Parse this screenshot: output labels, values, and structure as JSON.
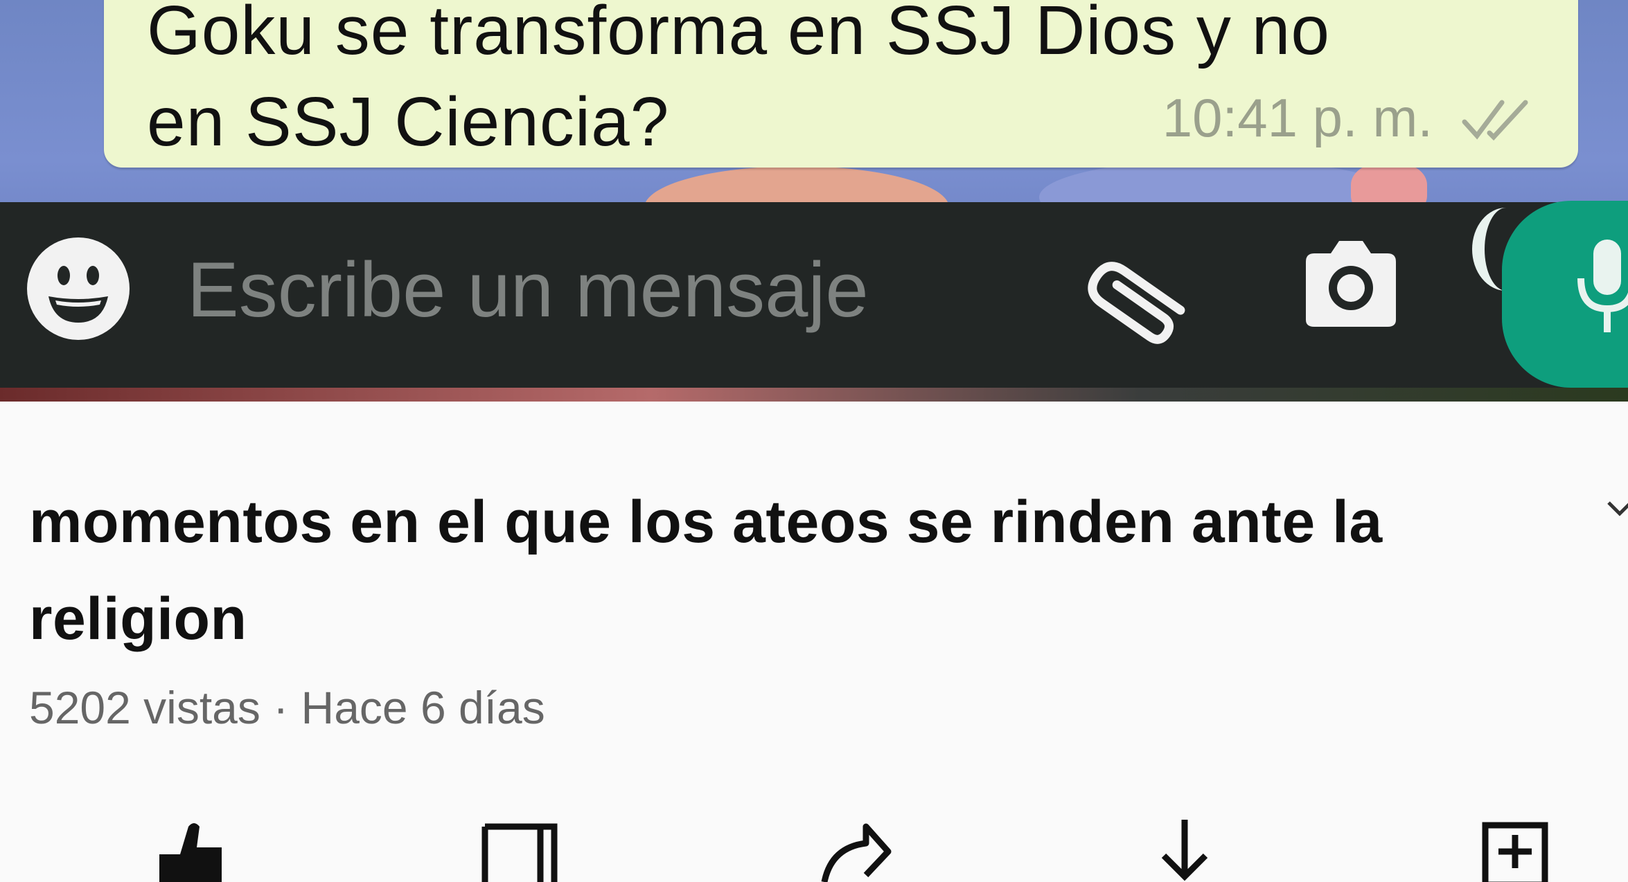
{
  "chat": {
    "message_text": "Goku se transforma en SSJ Dios y no\nen SSJ Ciencia?",
    "message_time": "10:41 p. m.",
    "input_placeholder": "Escribe un mensaje"
  },
  "video": {
    "title": "momentos en el que los ateos se rinden ante la religion",
    "views": "5202 vistas",
    "separator": "·",
    "age": "Hace 6 días"
  },
  "icons": {
    "emoji": "emoji-icon",
    "attach": "paperclip-icon",
    "camera": "camera-icon",
    "mic": "microphone-icon",
    "expand": "chevron-down-icon",
    "actions": [
      "like-icon",
      "dislike-icon",
      "share-icon",
      "download-icon",
      "save-icon"
    ]
  },
  "colors": {
    "bubble": "#eef7cf",
    "input_bar": "#222625",
    "mic_button": "#0e9e7d",
    "background": "#fafafa"
  }
}
